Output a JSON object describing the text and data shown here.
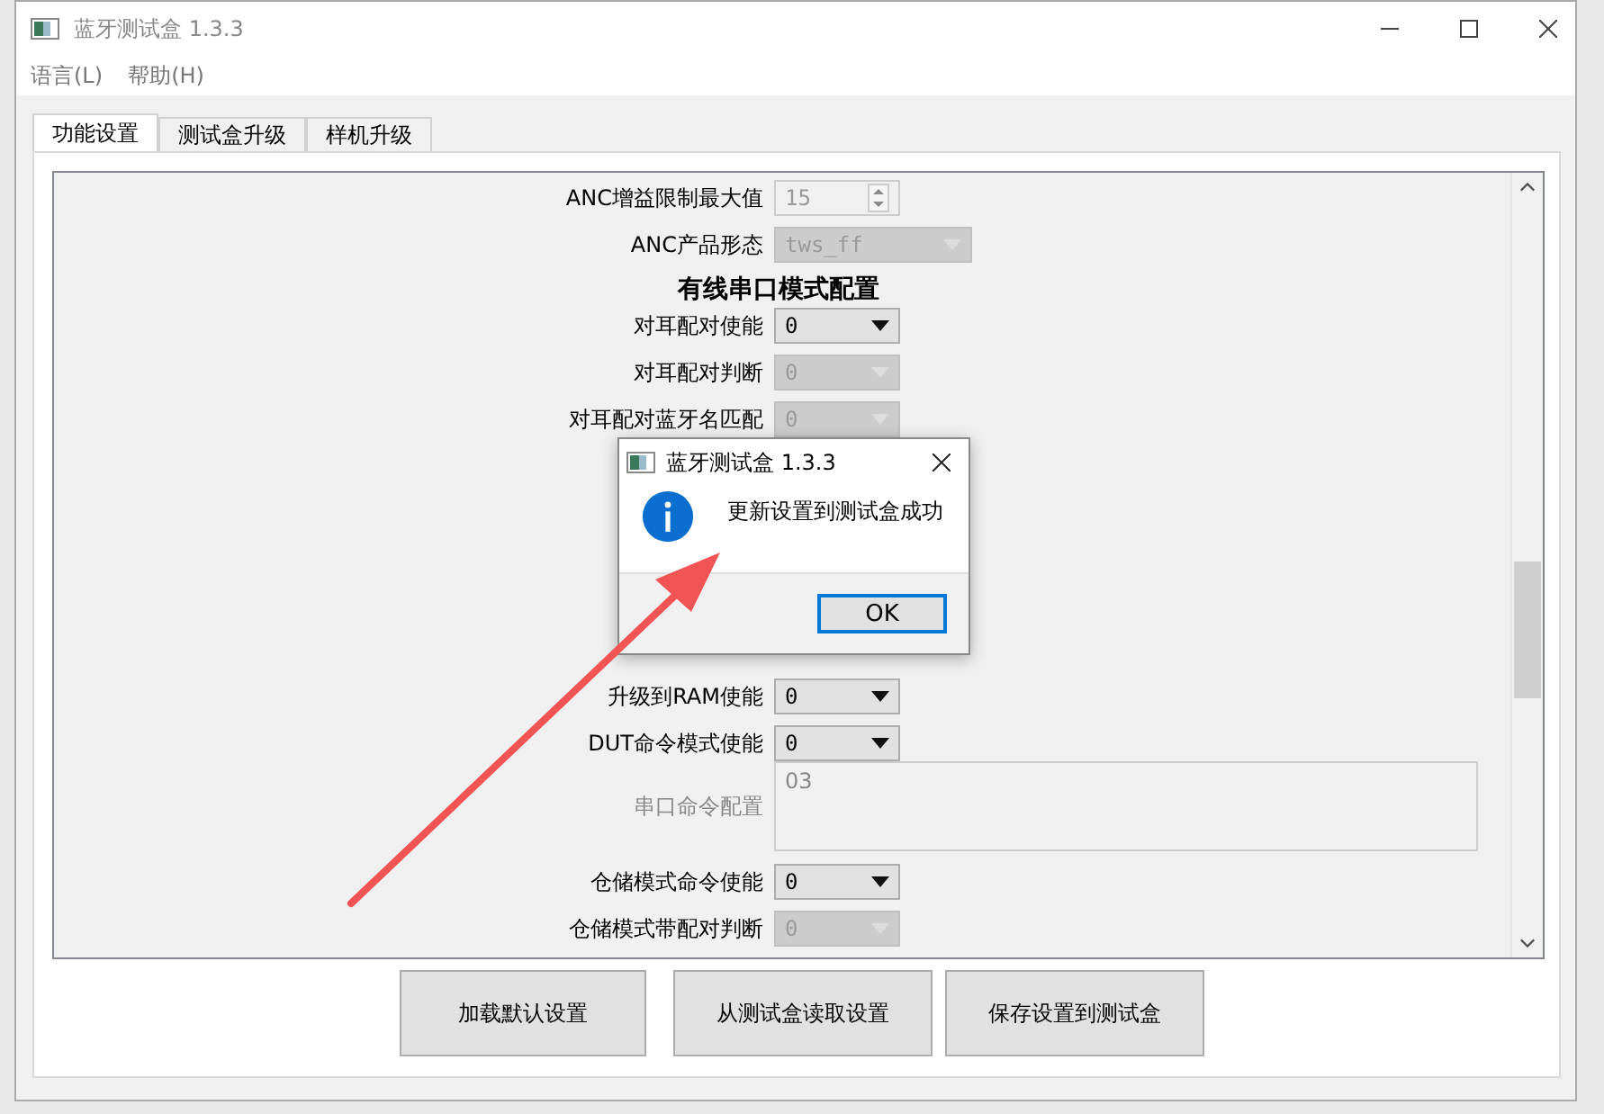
{
  "window": {
    "title": "蓝牙测试盒 1.3.3"
  },
  "menu": [
    "语言(L)",
    "帮助(H)"
  ],
  "tabs": [
    {
      "label": "功能设置",
      "selected": true
    },
    {
      "label": "测试盒升级",
      "selected": false
    },
    {
      "label": "样机升级",
      "selected": false
    }
  ],
  "rows_upper": [
    {
      "kind": "spin",
      "label": "ANC增益限制最大值",
      "value": "15",
      "disabled": true
    },
    {
      "kind": "combo",
      "label": "ANC产品形态",
      "value": "tws_ff",
      "disabled": true,
      "wide": true
    },
    {
      "kind": "heading",
      "label": "有线串口模式配置"
    },
    {
      "kind": "combo",
      "label": "对耳配对使能",
      "value": "0",
      "disabled": false
    },
    {
      "kind": "combo",
      "label": "对耳配对判断",
      "value": "0",
      "disabled": true
    },
    {
      "kind": "combo",
      "label": "对耳配对蓝牙名匹配",
      "value": "0",
      "disabled": true
    }
  ],
  "rows_lower": [
    {
      "kind": "combo",
      "label": "升级到RAM使能",
      "value": "0",
      "disabled": false
    },
    {
      "kind": "combo",
      "label": "DUT命令模式使能",
      "value": "0",
      "disabled": false
    },
    {
      "kind": "text",
      "label": "串口命令配置",
      "value": "03",
      "disabled": true
    },
    {
      "kind": "combo",
      "label": "仓储模式命令使能",
      "value": "0",
      "disabled": false
    },
    {
      "kind": "combo",
      "label": "仓储模式带配对判断",
      "value": "0",
      "disabled": true
    }
  ],
  "buttons": [
    "加载默认设置",
    "从测试盒读取设置",
    "保存设置到测试盒"
  ],
  "dialog": {
    "title": "蓝牙测试盒 1.3.3",
    "message": "更新设置到测试盒成功",
    "button": "OK"
  }
}
